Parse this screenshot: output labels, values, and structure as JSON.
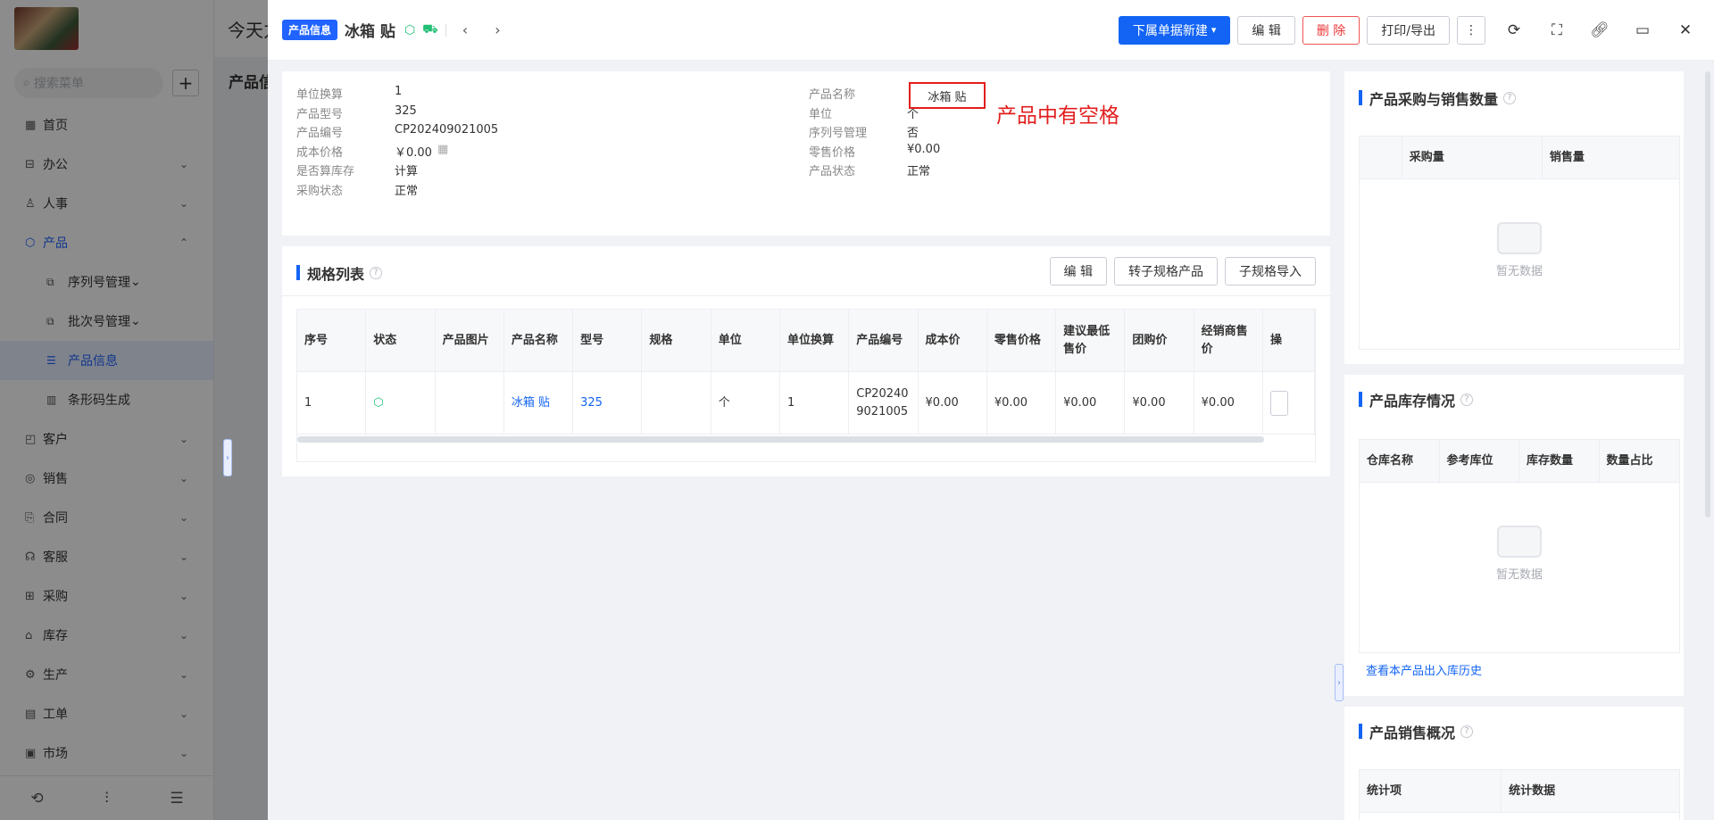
{
  "sidebar": {
    "search_placeholder": "搜索菜单",
    "add_label": "+",
    "items": [
      {
        "label": "首页",
        "icon": "▦"
      },
      {
        "label": "办公",
        "icon": "⊟"
      },
      {
        "label": "人事",
        "icon": "♙"
      },
      {
        "label": "产品",
        "icon": "⬡"
      },
      {
        "label": "序列号管理",
        "icon": "⧉"
      },
      {
        "label": "批次号管理",
        "icon": "⧉"
      },
      {
        "label": "产品信息",
        "icon": "☰"
      },
      {
        "label": "条形码生成",
        "icon": "▥"
      },
      {
        "label": "客户",
        "icon": "◰"
      },
      {
        "label": "销售",
        "icon": "◎"
      },
      {
        "label": "合同",
        "icon": "⎘"
      },
      {
        "label": "客服",
        "icon": "☊"
      },
      {
        "label": "采购",
        "icon": "⊞"
      },
      {
        "label": "库存",
        "icon": "⌂"
      },
      {
        "label": "生产",
        "icon": "⚙"
      },
      {
        "label": "工单",
        "icon": "▤"
      },
      {
        "label": "市场",
        "icon": "▣"
      }
    ],
    "bottom_icons": [
      "history-icon",
      "sliders-icon",
      "menu-collapse-icon"
    ]
  },
  "background": {
    "top_text": "今天力",
    "title": "产品信"
  },
  "drawer": {
    "tag": "产品信息",
    "name": "冰箱 贴",
    "actions": {
      "new_label": "下属单据新建",
      "edit_label": "编 辑",
      "delete_label": "删 除",
      "print_label": "打印/导出",
      "more_label": "⋮"
    }
  },
  "info": {
    "left": [
      {
        "label": "单位换算",
        "value": "1"
      },
      {
        "label": "产品型号",
        "value": "325"
      },
      {
        "label": "产品编号",
        "value": "CP202409021005"
      },
      {
        "label": "成本价格",
        "value": "￥0.00"
      },
      {
        "label": "是否算库存",
        "value": "计算"
      },
      {
        "label": "采购状态",
        "value": "正常"
      }
    ],
    "right": [
      {
        "label": "产品名称",
        "value": "冰箱 贴"
      },
      {
        "label": "单位",
        "value": "个"
      },
      {
        "label": "序列号管理",
        "value": "否"
      },
      {
        "label": "零售价格",
        "value": "¥0.00"
      },
      {
        "label": "产品状态",
        "value": "正常"
      }
    ],
    "annotation": "产品中有空格"
  },
  "spec": {
    "title": "规格列表",
    "buttons": {
      "edit": "编 辑",
      "convert": "转子规格产品",
      "import": "子规格导入"
    },
    "columns": [
      "序号",
      "状态",
      "产品图片",
      "产品名称",
      "型号",
      "规格",
      "单位",
      "单位换算",
      "产品编号",
      "成本价",
      "零售价格",
      "建议最低售价",
      "团购价",
      "经销商售价",
      "操"
    ],
    "row": {
      "index": "1",
      "name": "冰箱 贴",
      "model": "325",
      "spec": "",
      "unit": "个",
      "conversion": "1",
      "code": "CP202409021005",
      "cost": "¥0.00",
      "retail": "¥0.00",
      "min_price": "¥0.00",
      "group_price": "¥0.00",
      "dealer_price": "¥0.00"
    }
  },
  "purchase_sales": {
    "title": "产品采购与销售数量",
    "columns": [
      "采购量",
      "销售量"
    ],
    "empty": "暂无数据"
  },
  "stock": {
    "title": "产品库存情况",
    "columns": [
      "仓库名称",
      "参考库位",
      "库存数量",
      "数量占比"
    ],
    "empty": "暂无数据",
    "history_link": "查看本产品出入库历史"
  },
  "sales_overview": {
    "title": "产品销售概况",
    "columns": [
      "统计项",
      "统计数据"
    ]
  },
  "colors": {
    "primary": "#1364f5",
    "danger": "#e21d1d",
    "success": "#1fbf74"
  }
}
